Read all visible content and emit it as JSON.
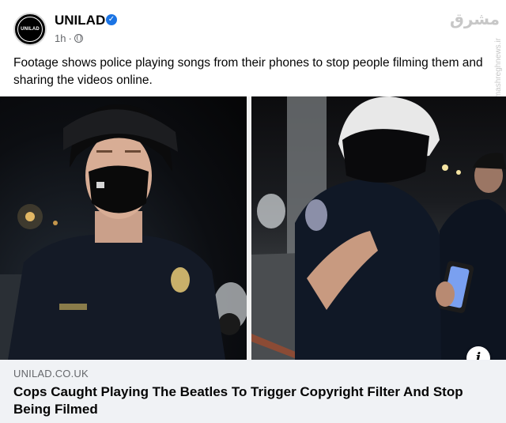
{
  "post": {
    "page_name": "UNILAD",
    "avatar_text": "UNILAD",
    "time": "1h",
    "separator": "·",
    "caption": "Footage shows police playing songs from their phones to stop people filming them and sharing the videos online."
  },
  "watermark": {
    "main": "مشرق",
    "vertical": "mashreghnews.ir"
  },
  "link_preview": {
    "domain": "UNILAD.CO.UK",
    "title": "Cops Caught Playing The Beatles To Trigger Copyright Filter And Stop Being Filmed"
  },
  "info_button": "i",
  "colors": {
    "verified": "#1b74e4",
    "link_bg": "#f0f2f5",
    "meta_text": "#65676b"
  }
}
